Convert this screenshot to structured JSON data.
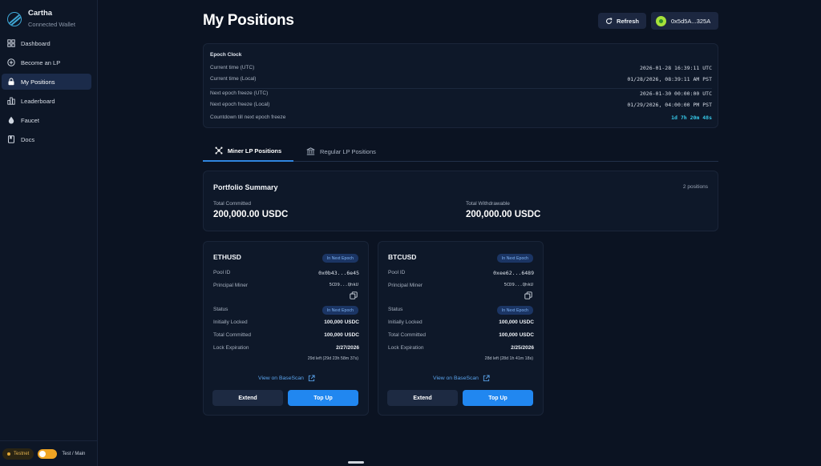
{
  "sidebar": {
    "brand_name": "Cartha",
    "brand_sub": "Connected Wallet",
    "items": [
      {
        "label": "Dashboard",
        "icon": "dashboard-icon",
        "active": false
      },
      {
        "label": "Become an LP",
        "icon": "plus-circle-icon",
        "active": false
      },
      {
        "label": "My Positions",
        "icon": "lock-icon",
        "active": true
      },
      {
        "label": "Leaderboard",
        "icon": "bar-chart-icon",
        "active": false
      },
      {
        "label": "Faucet",
        "icon": "droplet-icon",
        "active": false
      },
      {
        "label": "Docs",
        "icon": "book-icon",
        "active": false
      }
    ],
    "network_badge": "Testnet",
    "toggle_label": "Test / Main"
  },
  "header": {
    "title": "My Positions",
    "refresh_label": "Refresh",
    "wallet_address": "0x5d5A...325A"
  },
  "epoch": {
    "title": "Epoch Clock",
    "rows": [
      {
        "label": "Current time (UTC)",
        "value": "2026-01-28 16:39:11 UTC"
      },
      {
        "label": "Current time (Local)",
        "value": "01/28/2026, 08:39:11 AM PST"
      },
      {
        "label": "Next epoch freeze (UTC)",
        "value": "2026-01-30 00:00:00 UTC"
      },
      {
        "label": "Next epoch freeze (Local)",
        "value": "01/29/2026, 04:00:00 PM PST"
      },
      {
        "label": "Countdown till next epoch freeze",
        "value": "1d 7h 20m 48s"
      }
    ]
  },
  "tabs": {
    "miner": "Miner LP Positions",
    "regular": "Regular LP Positions"
  },
  "summary": {
    "title": "Portfolio Summary",
    "count": "2 positions",
    "committed_label": "Total Committed",
    "committed_value": "200,000.00 USDC",
    "withdrawable_label": "Total Withdrawable",
    "withdrawable_value": "200,000.00 USDC"
  },
  "labels": {
    "pool_id": "Pool ID",
    "principal_miner": "Principal Miner",
    "status": "Status",
    "initially_locked": "Initially Locked",
    "total_committed": "Total Committed",
    "lock_expiration": "Lock Expiration",
    "view_basescan": "View on BaseScan",
    "extend": "Extend",
    "top_up": "Top Up"
  },
  "positions": [
    {
      "symbol": "ETHUSD",
      "badge": "In Next Epoch",
      "pool_id": "0x0b43...6e45",
      "principal_miner": "5CD9...QhkU",
      "status": "In Next Epoch",
      "initially_locked": "100,000 USDC",
      "total_committed": "100,000 USDC",
      "lock_expiration": "2/27/2026",
      "time_left": "29d left (29d 23h 58m 37s)"
    },
    {
      "symbol": "BTCUSD",
      "badge": "In Next Epoch",
      "pool_id": "0xee62...6489",
      "principal_miner": "5CD9...QhkU",
      "status": "In Next Epoch",
      "initially_locked": "100,000 USDC",
      "total_committed": "100,000 USDC",
      "lock_expiration": "2/25/2026",
      "time_left": "28d left (28d 1h 41m 18s)"
    }
  ]
}
